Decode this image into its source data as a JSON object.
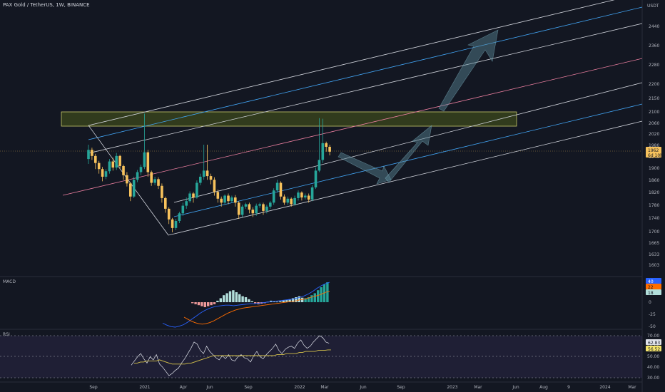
{
  "header": {
    "title": "PAX Gold / TetherUS, 1W, BINANCE"
  },
  "price_axis": {
    "currency": "USDT",
    "ticks": [
      "2440",
      "2360",
      "2280",
      "2200",
      "2150",
      "2100",
      "2060",
      "2020",
      "1980",
      "1940",
      "1900",
      "1860",
      "1820",
      "1780",
      "1740",
      "1700",
      "1665",
      "1633",
      "1603"
    ]
  },
  "price_badge": {
    "value": "1962",
    "countdown": "6d 10h"
  },
  "macd": {
    "label": "MACD",
    "ticks": [
      "25",
      "0",
      "-25",
      "-50"
    ],
    "badges": [
      "40",
      "22",
      "18"
    ]
  },
  "rsi": {
    "label": "RSI",
    "ticks": [
      "70.00",
      "60.00",
      "50.00",
      "40.00",
      "30.00"
    ],
    "badges": [
      "62.83",
      "56.52"
    ]
  },
  "time_axis": {
    "ticks": [
      "Sep",
      "2021",
      "Apr",
      "Jun",
      "Sep",
      "2022",
      "Mar",
      "Jun",
      "Sep",
      "2023",
      "Mar",
      "Jun",
      "Aug",
      "9",
      "2024",
      "Mar"
    ]
  },
  "colors": {
    "background": "#131722",
    "up": "#26a69a",
    "down": "#f7c25c",
    "zone": "#4b5a1a",
    "zone_border": "#c9c96b",
    "macd_line": "#2962ff",
    "signal_line": "#ff6d00",
    "rsi_line": "#e0e3eb",
    "rsi_ma": "#d6c34b",
    "arrow": "#5b8a9a"
  },
  "chart_data": {
    "type": "candlestick",
    "ylim": [
      1600,
      2480
    ],
    "zone": [
      2043,
      2087
    ],
    "candles": [
      [
        1938,
        1968,
        1922,
        1985
      ],
      [
        1968,
        1948,
        1935,
        1975
      ],
      [
        1948,
        1925,
        1905,
        1955
      ],
      [
        1925,
        1905,
        1890,
        1932
      ],
      [
        1905,
        1880,
        1865,
        1912
      ],
      [
        1880,
        1898,
        1872,
        1905
      ],
      [
        1898,
        1930,
        1890,
        1938
      ],
      [
        1930,
        1910,
        1900,
        1942
      ],
      [
        1910,
        1948,
        1902,
        1958
      ],
      [
        1948,
        1915,
        1905,
        1952
      ],
      [
        1915,
        1885,
        1870,
        1920
      ],
      [
        1885,
        1858,
        1848,
        1895
      ],
      [
        1858,
        1815,
        1800,
        1862
      ],
      [
        1815,
        1870,
        1810,
        1880
      ],
      [
        1870,
        1895,
        1862,
        1902
      ],
      [
        1895,
        1912,
        1885,
        1920
      ],
      [
        1912,
        1960,
        1905,
        2087
      ],
      [
        1960,
        1895,
        1880,
        1968
      ],
      [
        1895,
        1860,
        1850,
        1900
      ],
      [
        1860,
        1872,
        1852,
        1880
      ],
      [
        1872,
        1850,
        1840,
        1878
      ],
      [
        1850,
        1810,
        1795,
        1858
      ],
      [
        1810,
        1775,
        1762,
        1815
      ],
      [
        1775,
        1740,
        1725,
        1780
      ],
      [
        1740,
        1712,
        1698,
        1745
      ],
      [
        1712,
        1735,
        1705,
        1742
      ],
      [
        1735,
        1760,
        1728,
        1765
      ],
      [
        1760,
        1785,
        1752,
        1795
      ],
      [
        1785,
        1800,
        1775,
        1812
      ],
      [
        1800,
        1825,
        1795,
        1832
      ],
      [
        1825,
        1812,
        1795,
        1830
      ],
      [
        1812,
        1860,
        1808,
        1868
      ],
      [
        1860,
        1880,
        1852,
        1890
      ],
      [
        1880,
        1900,
        1870,
        1985
      ],
      [
        1900,
        1882,
        1870,
        1985
      ],
      [
        1882,
        1870,
        1855,
        1890
      ],
      [
        1870,
        1830,
        1818,
        1878
      ],
      [
        1830,
        1808,
        1795,
        1838
      ],
      [
        1808,
        1795,
        1782,
        1815
      ],
      [
        1795,
        1818,
        1788,
        1822
      ],
      [
        1818,
        1800,
        1790,
        1825
      ],
      [
        1800,
        1812,
        1795,
        1818
      ],
      [
        1812,
        1795,
        1782,
        1820
      ],
      [
        1795,
        1755,
        1742,
        1800
      ],
      [
        1755,
        1782,
        1748,
        1788
      ],
      [
        1782,
        1790,
        1775,
        1795
      ],
      [
        1790,
        1772,
        1760,
        1795
      ],
      [
        1772,
        1760,
        1748,
        1780
      ],
      [
        1760,
        1785,
        1752,
        1792
      ],
      [
        1785,
        1790,
        1778,
        1795
      ],
      [
        1790,
        1768,
        1755,
        1795
      ],
      [
        1768,
        1782,
        1760,
        1788
      ],
      [
        1782,
        1795,
        1775,
        1800
      ],
      [
        1795,
        1835,
        1788,
        1842
      ],
      [
        1835,
        1860,
        1828,
        1870
      ],
      [
        1860,
        1815,
        1805,
        1865
      ],
      [
        1815,
        1795,
        1788,
        1822
      ],
      [
        1795,
        1808,
        1788,
        1815
      ],
      [
        1808,
        1790,
        1782,
        1812
      ],
      [
        1790,
        1810,
        1785,
        1818
      ],
      [
        1810,
        1828,
        1802,
        1835
      ],
      [
        1828,
        1812,
        1802,
        1832
      ],
      [
        1812,
        1818,
        1805,
        1825
      ],
      [
        1818,
        1805,
        1795,
        1825
      ],
      [
        1805,
        1845,
        1800,
        1852
      ],
      [
        1845,
        1900,
        1840,
        1910
      ],
      [
        1900,
        1935,
        1895,
        2072
      ],
      [
        1935,
        1990,
        1925,
        2070
      ],
      [
        1990,
        1978,
        1962,
        1995
      ],
      [
        1978,
        1962,
        1950,
        1985
      ]
    ],
    "macd_hist": [
      -2,
      -4,
      -6,
      -8,
      -10,
      -8,
      -6,
      -4,
      3,
      8,
      14,
      18,
      22,
      24,
      20,
      16,
      12,
      10,
      6,
      2,
      -2,
      -4,
      -3,
      -2,
      1,
      3,
      2,
      1,
      2,
      4,
      5,
      6,
      8,
      10,
      12,
      9,
      8,
      10,
      14,
      18,
      24,
      30,
      36,
      40
    ],
    "macd_line": [
      -42,
      -46,
      -49,
      -50,
      -48,
      -45,
      -40,
      -34,
      -28,
      -22,
      -17,
      -13,
      -10,
      -8,
      -7,
      -6,
      -6,
      -7,
      -6,
      -5,
      -4,
      -3,
      -3,
      -2,
      -1,
      0,
      1,
      2,
      3,
      4,
      5,
      6,
      8,
      10,
      13,
      17,
      22,
      28,
      33,
      37,
      40
    ],
    "macd_signal": [
      -30,
      -34,
      -38,
      -41,
      -43,
      -44,
      -43,
      -41,
      -38,
      -34,
      -30,
      -26,
      -22,
      -19,
      -16,
      -14,
      -12,
      -11,
      -10,
      -9,
      -8,
      -7,
      -6,
      -5,
      -4,
      -3,
      -2,
      -1,
      0,
      1,
      2,
      3,
      5,
      6,
      8,
      10,
      12,
      14,
      17,
      20,
      22
    ],
    "rsi_line": [
      42,
      46,
      50,
      53,
      48,
      44,
      50,
      47,
      52,
      43,
      40,
      36,
      32,
      34,
      37,
      39,
      44,
      48,
      53,
      58,
      64,
      62,
      56,
      53,
      60,
      55,
      52,
      49,
      47,
      51,
      48,
      52,
      47,
      46,
      50,
      52,
      49,
      48,
      45,
      51,
      55,
      50,
      48,
      52,
      55,
      58,
      62,
      56,
      53,
      57,
      59,
      60,
      58,
      63,
      66,
      61,
      58,
      60,
      64,
      67,
      70,
      68,
      64,
      62.83
    ],
    "rsi_ma": [
      44,
      44,
      45,
      45,
      46,
      46,
      46,
      46,
      47,
      46,
      45,
      44,
      43,
      43,
      43,
      43,
      43,
      44,
      44,
      45,
      46,
      47,
      48,
      49,
      50,
      51,
      51,
      51,
      51,
      51,
      51,
      51,
      51,
      51,
      51,
      51,
      51,
      51,
      51,
      51,
      51,
      51,
      51,
      51,
      51,
      52,
      52,
      52,
      53,
      53,
      53,
      53,
      54,
      54,
      55,
      55,
      55,
      55,
      56,
      56,
      56,
      56.5,
      56.52
    ]
  }
}
